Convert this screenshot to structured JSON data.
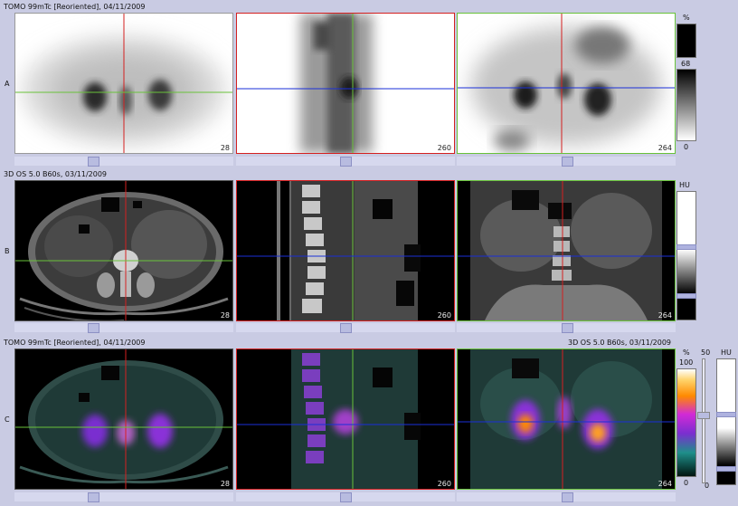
{
  "rows": [
    {
      "letter": "A",
      "title": "TOMO 99mTc [Reoriented], 04/11/2009",
      "title_right": ""
    },
    {
      "letter": "B",
      "title": "3D  OS  5.0  B60s, 03/11/2009",
      "title_right": ""
    },
    {
      "letter": "C",
      "title": "TOMO 99mTc [Reoriented], 04/11/2009",
      "title_right": "3D  OS  5.0  B60s, 03/11/2009"
    }
  ],
  "slices": {
    "a1": "28",
    "a2": "260",
    "a3": "264",
    "b1": "28",
    "b2": "260",
    "b3": "264",
    "c1": "28",
    "c2": "260",
    "c3": "264"
  },
  "colorbars": {
    "a": {
      "unit": "%",
      "max": "68",
      "min": "0"
    },
    "b": {
      "unit": "HU"
    },
    "c_pct": {
      "unit": "%",
      "max": "100",
      "min": "0"
    },
    "c_hu": {
      "unit": "HU"
    },
    "c_opacity": {
      "top": "50",
      "bottom": "0"
    }
  },
  "colors": {
    "background": "#c9cbe3",
    "crosshair_red": "#d42020",
    "crosshair_green": "#69c23a",
    "crosshair_blue": "#1a2fd8"
  }
}
